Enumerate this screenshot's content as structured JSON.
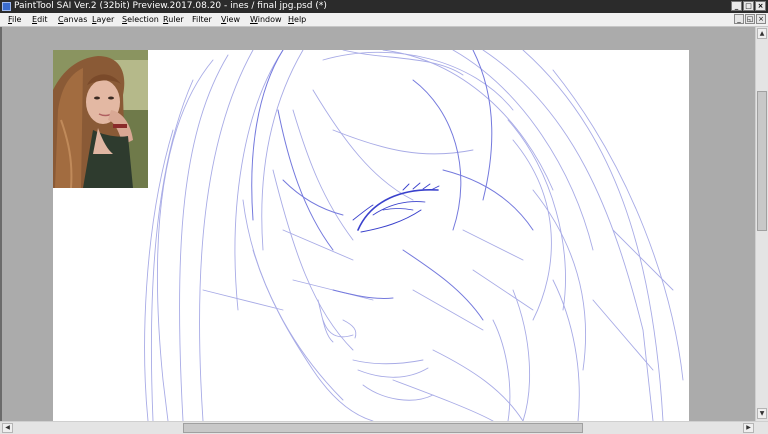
{
  "window": {
    "title": "PaintTool SAI Ver.2 (32bit) Preview.2017.08.20 - ines / final jpg.psd (*)",
    "minimize": "_",
    "maximize": "□",
    "close": "×"
  },
  "menu": {
    "items": [
      {
        "u": "F",
        "rest": "ile"
      },
      {
        "u": "E",
        "rest": "dit"
      },
      {
        "u": "C",
        "rest": "anvas"
      },
      {
        "u": "L",
        "rest": "ayer"
      },
      {
        "u": "S",
        "rest": "election"
      },
      {
        "u": "R",
        "rest": "uler"
      },
      {
        "u": "",
        "rest": "Filter"
      },
      {
        "u": "V",
        "rest": "iew"
      },
      {
        "u": "W",
        "rest": "indow"
      },
      {
        "u": "H",
        "rest": "elp"
      }
    ],
    "mdi_minimize": "_",
    "mdi_restore": "◱",
    "mdi_close": "×"
  },
  "scrollbars": {
    "up": "▲",
    "down": "▼",
    "left": "◀",
    "right": "▶"
  },
  "colors": {
    "sketch_line": "#5b62d6",
    "sketch_light": "#a8abe6",
    "canvas": "#ffffff",
    "workspace": "#ababab"
  }
}
